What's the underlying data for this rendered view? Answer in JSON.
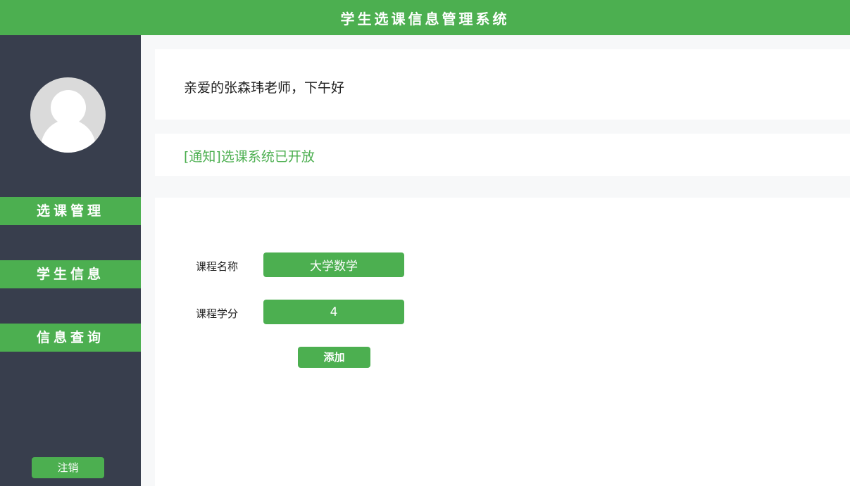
{
  "header": {
    "title": "学生选课信息管理系统"
  },
  "sidebar": {
    "avatar_icon": "user-avatar-icon",
    "items": [
      {
        "label": "选课管理"
      },
      {
        "label": "学生信息"
      },
      {
        "label": "信息查询"
      }
    ],
    "logout_label": "注销"
  },
  "main": {
    "greeting": "亲爱的张森玮老师，下午好",
    "notice": "[通知]选课系统已开放",
    "form": {
      "course_name_label": "课程名称",
      "course_name_value": "大学数学",
      "course_credit_label": "课程学分",
      "course_credit_value": "4",
      "add_label": "添加"
    }
  },
  "colors": {
    "accent": "#4caf50",
    "sidebar_bg": "#383e4d",
    "page_bg": "#f7f8f9"
  }
}
